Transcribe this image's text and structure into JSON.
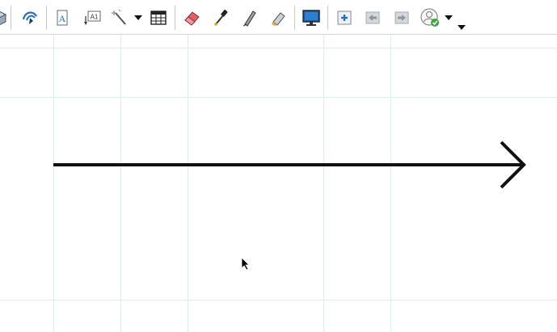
{
  "toolbar": {
    "tools": [
      {
        "id": "cube-icon",
        "icon": "3d-shape"
      },
      {
        "id": "arc-icon",
        "icon": "arc-pen"
      },
      {
        "id": "text-box-icon",
        "icon": "text-A"
      },
      {
        "id": "text-label-icon",
        "icon": "text-A1"
      },
      {
        "id": "magic-wand-icon",
        "icon": "magic-wand"
      },
      {
        "id": "table-icon",
        "icon": "table-grid"
      },
      {
        "id": "eraser-icon",
        "icon": "eraser"
      },
      {
        "id": "dropper-icon",
        "icon": "dropper"
      },
      {
        "id": "pen-icon",
        "icon": "pen-nib"
      },
      {
        "id": "highlighter-icon",
        "icon": "highlighter"
      },
      {
        "id": "monitor-icon",
        "icon": "display-screen"
      },
      {
        "id": "add-page-icon",
        "icon": "page-add"
      },
      {
        "id": "previous-page-icon",
        "icon": "page-back"
      },
      {
        "id": "next-page-icon",
        "icon": "page-forward"
      },
      {
        "id": "user-status-icon",
        "icon": "user-check"
      }
    ],
    "accent_colors": {
      "blue": "#2a6fbf",
      "red": "#e2606a",
      "green": "#3ea63e",
      "grid": "#d9f0f0"
    }
  },
  "canvas": {
    "grid": true,
    "content": "arrow-pointing-right"
  }
}
